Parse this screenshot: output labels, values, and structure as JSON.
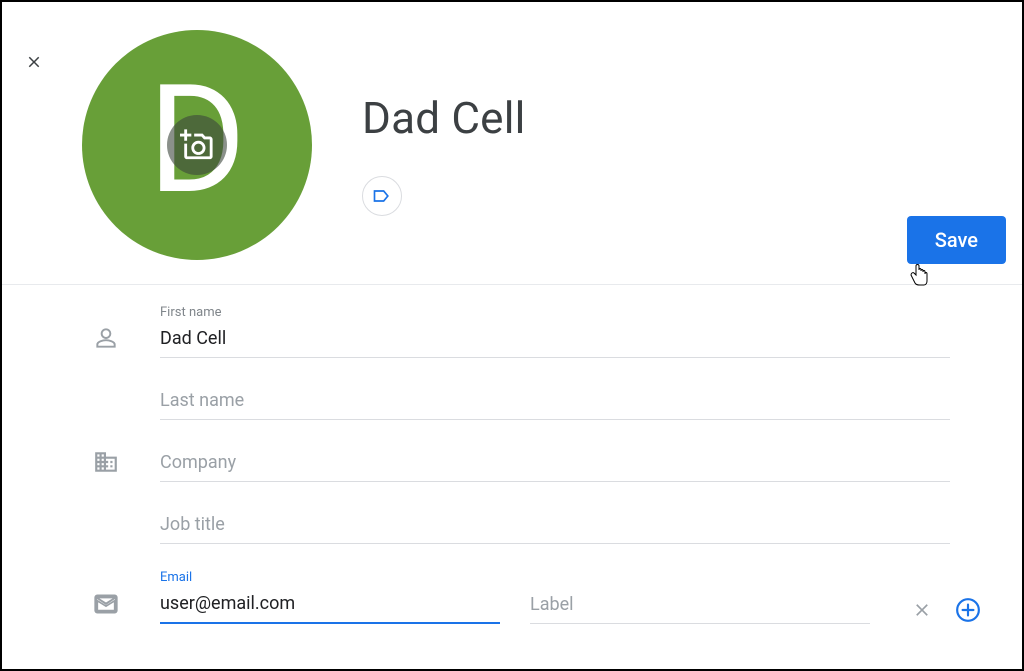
{
  "contact": {
    "name": "Dad Cell",
    "avatar_letter": "D"
  },
  "buttons": {
    "save": "Save"
  },
  "fields": {
    "first_name_label": "First name",
    "first_name_value": "Dad Cell",
    "last_name_placeholder": "Last name",
    "company_placeholder": "Company",
    "job_title_placeholder": "Job title",
    "email_label": "Email",
    "email_value": "user@email.com",
    "email_label_placeholder": "Label"
  },
  "colors": {
    "avatar_bg": "#689f38",
    "primary": "#1a73e8"
  }
}
